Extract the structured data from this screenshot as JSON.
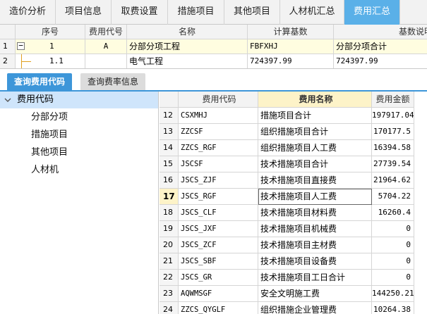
{
  "top_tabs": [
    {
      "label": "造价分析",
      "active": false
    },
    {
      "label": "项目信息",
      "active": false
    },
    {
      "label": "取费设置",
      "active": false
    },
    {
      "label": "措施项目",
      "active": false
    },
    {
      "label": "其他项目",
      "active": false
    },
    {
      "label": "人材机汇总",
      "active": false
    },
    {
      "label": "费用汇总",
      "active": true
    }
  ],
  "upper_grid": {
    "headers": [
      "序号",
      "费用代号",
      "名称",
      "计算基数",
      "基数说明"
    ],
    "rows": [
      {
        "row_no": "1",
        "collapse": "−",
        "seq": "1",
        "code": "A",
        "name": "分部分项工程",
        "base": "FBFXHJ",
        "desc": "分部分项合计"
      },
      {
        "row_no": "2",
        "collapse": "",
        "seq": "1.1",
        "code": "",
        "name": "电气工程",
        "base": "724397.99",
        "desc": "724397.99"
      }
    ]
  },
  "lower_tabs": [
    {
      "label": "查询费用代码",
      "active": true
    },
    {
      "label": "查询费率信息",
      "active": false
    }
  ],
  "tree": {
    "root": "费用代码",
    "items": [
      "分部分项",
      "措施项目",
      "其他项目",
      "人材机"
    ]
  },
  "right_grid": {
    "headers": [
      "费用代码",
      "费用名称",
      "费用金额"
    ],
    "rows": [
      {
        "no": "12",
        "code": "CSXMHJ",
        "name": "措施项目合计",
        "amount": "197917.04"
      },
      {
        "no": "13",
        "code": "ZZCSF",
        "name": "组织措施项目合计",
        "amount": "170177.5"
      },
      {
        "no": "14",
        "code": "ZZCS_RGF",
        "name": "组织措施项目人工费",
        "amount": "16394.58"
      },
      {
        "no": "15",
        "code": "JSCSF",
        "name": "技术措施项目合计",
        "amount": "27739.54"
      },
      {
        "no": "16",
        "code": "JSCS_ZJF",
        "name": "技术措施项目直接费",
        "amount": "21964.62"
      },
      {
        "no": "17",
        "code": "JSCS_RGF",
        "name": "技术措施项目人工费",
        "amount": "5704.22"
      },
      {
        "no": "18",
        "code": "JSCS_CLF",
        "name": "技术措施项目材料费",
        "amount": "16260.4"
      },
      {
        "no": "19",
        "code": "JSCS_JXF",
        "name": "技术措施项目机械费",
        "amount": "0"
      },
      {
        "no": "20",
        "code": "JSCS_ZCF",
        "name": "技术措施项目主材费",
        "amount": "0"
      },
      {
        "no": "21",
        "code": "JSCS_SBF",
        "name": "技术措施项目设备费",
        "amount": "0"
      },
      {
        "no": "22",
        "code": "JSCS_GR",
        "name": "技术措施项目工日合计",
        "amount": "0"
      },
      {
        "no": "23",
        "code": "AQWMSGF",
        "name": "安全文明施工费",
        "amount": "144250.21"
      },
      {
        "no": "24",
        "code": "ZZCS_QYGLF",
        "name": "组织措施企业管理费",
        "amount": "10264.38"
      }
    ],
    "selected_no": "17"
  },
  "colors": {
    "active_tab": "#5ab0e8",
    "lower_active_tab": "#3d96d9",
    "tree_root_bg": "#cfe5fb",
    "highlight": "#fffde0"
  }
}
